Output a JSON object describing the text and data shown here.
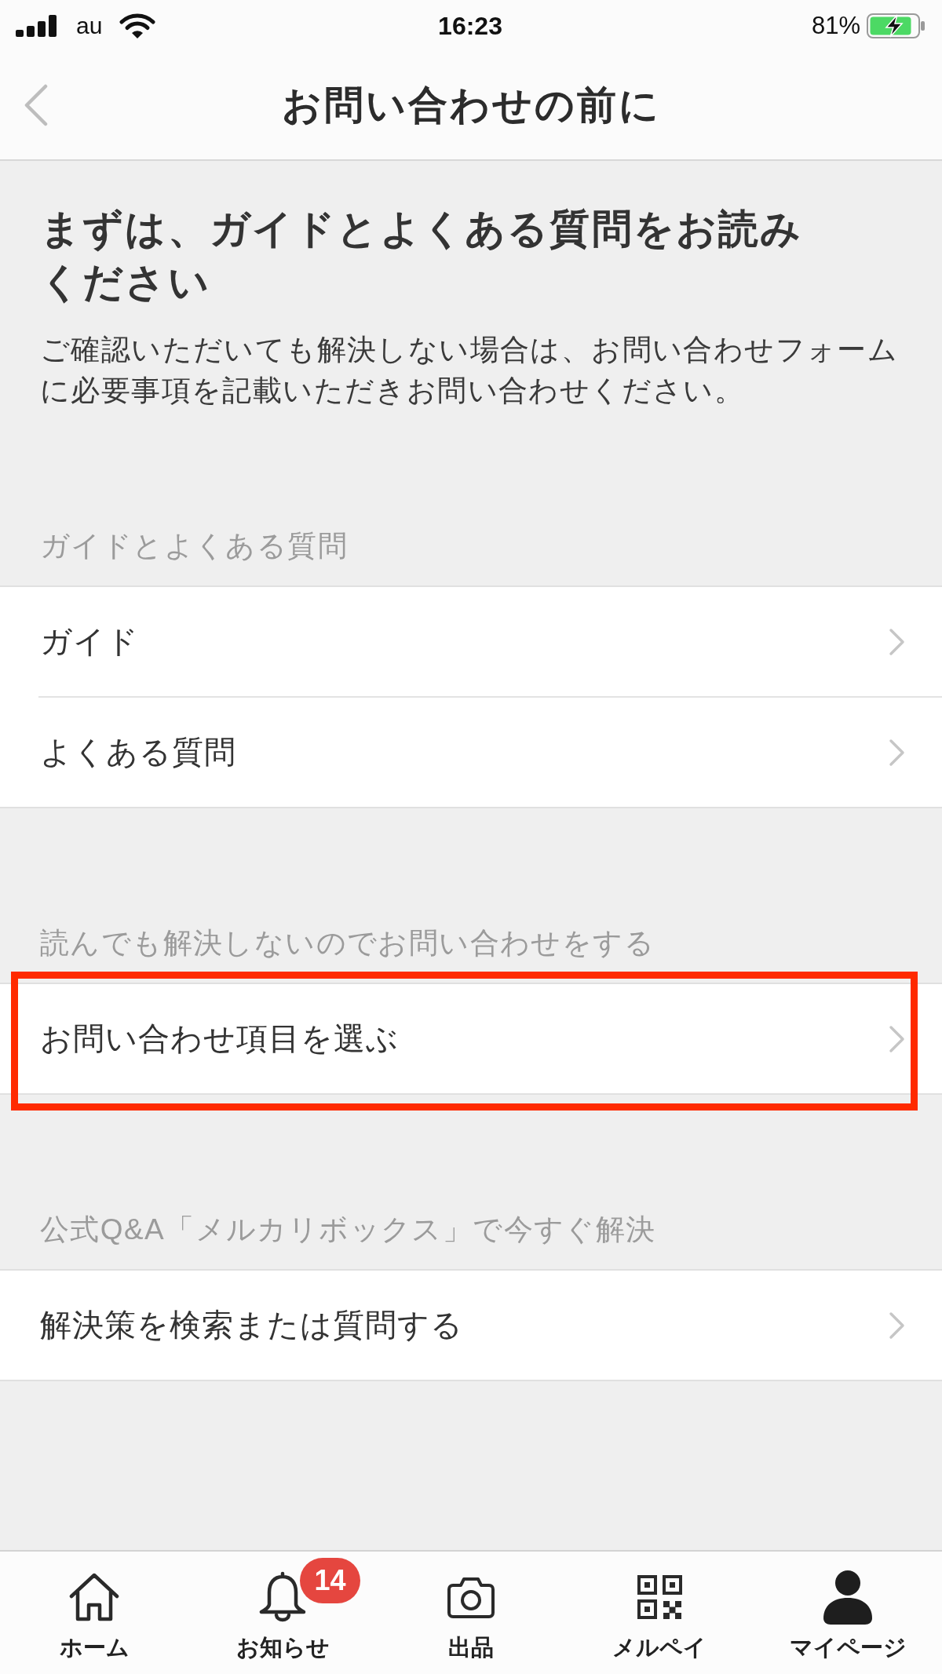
{
  "status_bar": {
    "carrier": "au",
    "time": "16:23",
    "battery": "81%"
  },
  "nav": {
    "title": "お問い合わせの前に"
  },
  "intro": {
    "heading": "まずは、ガイドとよくある質問をお読みください",
    "text": "ご確認いただいても解決しない場合は、お問い合わせフォームに必要事項を記載いただきお問い合わせください。"
  },
  "sections": [
    {
      "header": "ガイドとよくある質問",
      "rows": [
        {
          "label": "ガイド",
          "highlighted": false
        },
        {
          "label": "よくある質問",
          "highlighted": false
        }
      ]
    },
    {
      "header": "読んでも解決しないのでお問い合わせをする",
      "rows": [
        {
          "label": "お問い合わせ項目を選ぶ",
          "highlighted": true
        }
      ]
    },
    {
      "header": "公式Q&A「メルカリボックス」で今すぐ解決",
      "rows": [
        {
          "label": "解決策を検索または質問する",
          "highlighted": false
        }
      ]
    }
  ],
  "tab_bar": [
    {
      "label": "ホーム"
    },
    {
      "label": "お知らせ",
      "badge": "14"
    },
    {
      "label": "出品"
    },
    {
      "label": "メルペイ"
    },
    {
      "label": "マイページ"
    }
  ]
}
